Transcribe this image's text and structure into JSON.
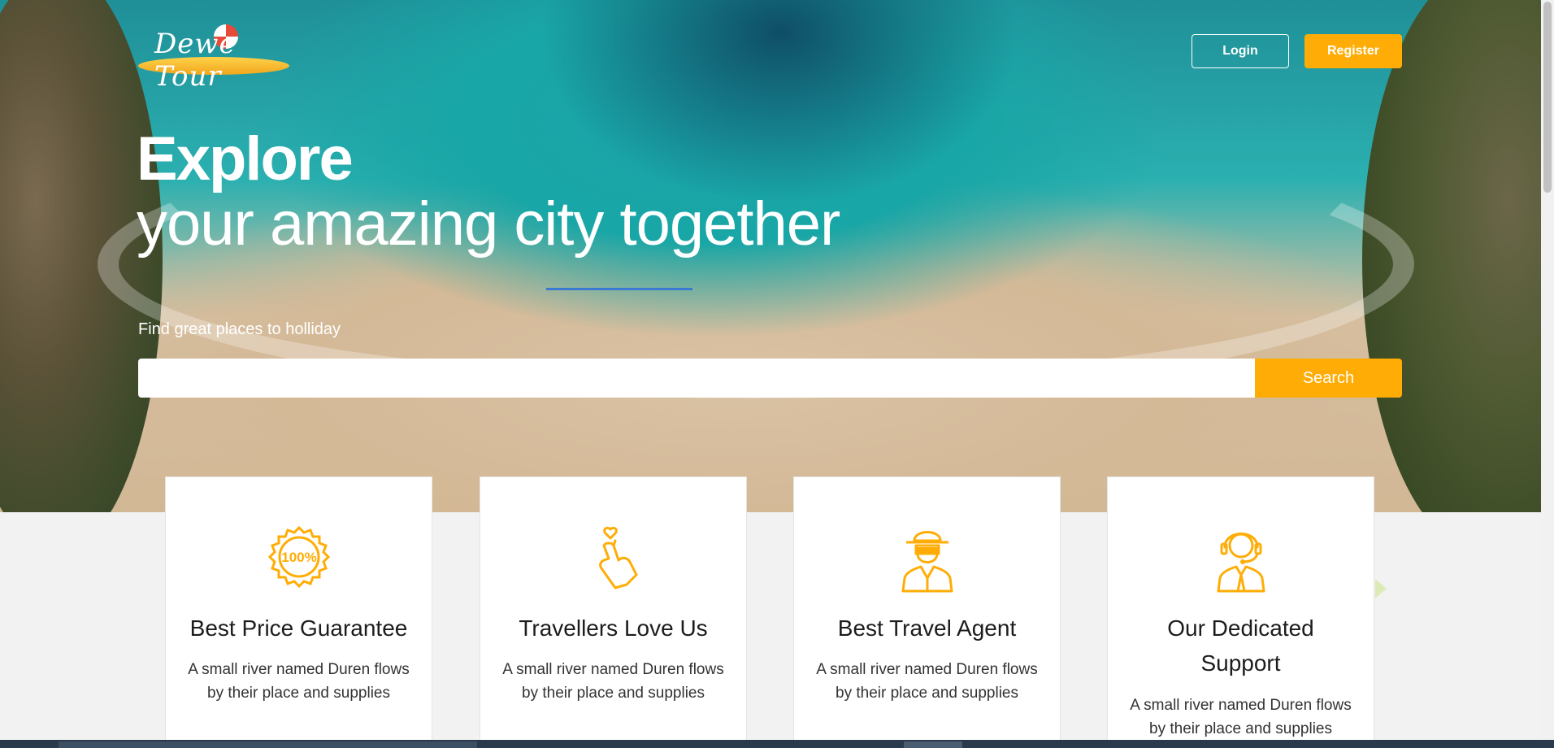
{
  "brand": {
    "name": "Dewe Tour"
  },
  "header": {
    "login_label": "Login",
    "register_label": "Register"
  },
  "hero": {
    "title_bold": "Explore",
    "title_light": "your amazing city together",
    "subtitle": "Find great places to holliday",
    "search_placeholder": "",
    "search_label": "Search"
  },
  "features": [
    {
      "icon": "100-percent-badge-icon",
      "title": "Best Price Guarantee",
      "description": "A small river named Duren flows by their place and supplies"
    },
    {
      "icon": "heart-hand-icon",
      "title": "Travellers Love Us",
      "description": "A small river named Duren flows by their place and supplies"
    },
    {
      "icon": "travel-agent-icon",
      "title": "Best Travel Agent",
      "description": "A small river named Duren flows by their place and supplies"
    },
    {
      "icon": "support-headset-icon",
      "title_line1": "Our Dedicated",
      "title_line2": "Support",
      "description": "A small river named Duren flows by their place and supplies"
    }
  ],
  "colors": {
    "accent": "#ffad06",
    "hero_ocean": "#1aa3a8",
    "card_bg": "#ffffff",
    "page_bg": "#f2f2f2"
  }
}
